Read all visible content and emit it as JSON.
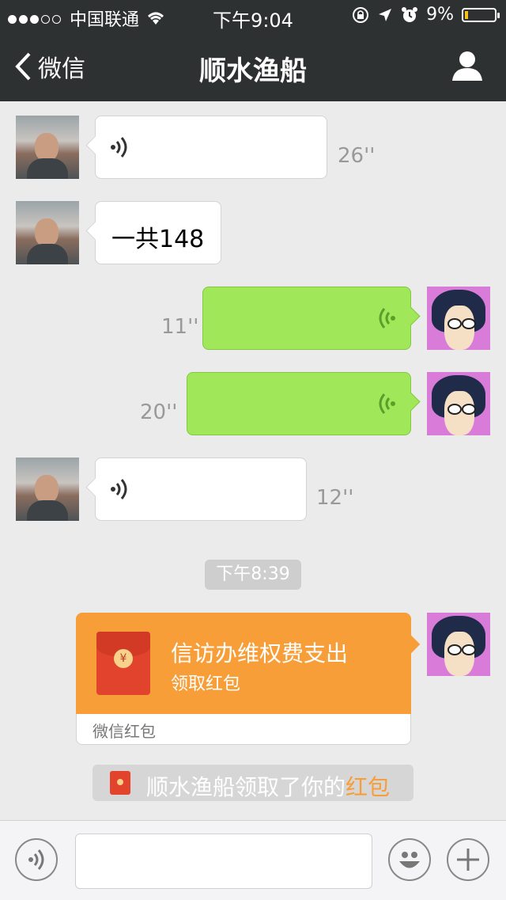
{
  "status_bar": {
    "carrier": "中国联通",
    "time": "下午9:04",
    "battery": "9%"
  },
  "nav": {
    "back_label": "微信",
    "title": "顺水渔船"
  },
  "messages": [
    {
      "from": "other",
      "type": "voice",
      "duration": "26''"
    },
    {
      "from": "other",
      "type": "text",
      "text": "一共148"
    },
    {
      "from": "me",
      "type": "voice",
      "duration": "11''"
    },
    {
      "from": "me",
      "type": "voice",
      "duration": "20''"
    },
    {
      "from": "other",
      "type": "voice",
      "duration": "12''"
    }
  ],
  "timestamp": "下午8:39",
  "red_packet": {
    "title": "信访办维权费支出",
    "subtitle": "领取红包",
    "footer": "微信红包",
    "coin_symbol": "¥"
  },
  "notice": {
    "text": "顺水渔船领取了你的",
    "highlight": "红包"
  },
  "colors": {
    "nav_bg": "#2e3132",
    "green_bubble": "#a0e75a",
    "red_packet": "#f79e39",
    "highlight": "#f79e39"
  },
  "icons": [
    "signal-icon",
    "wifi-icon",
    "lock-rotation-icon",
    "location-icon",
    "alarm-icon",
    "battery-icon",
    "back-chevron-icon",
    "profile-icon",
    "voice-icon",
    "emoji-icon",
    "plus-icon"
  ]
}
